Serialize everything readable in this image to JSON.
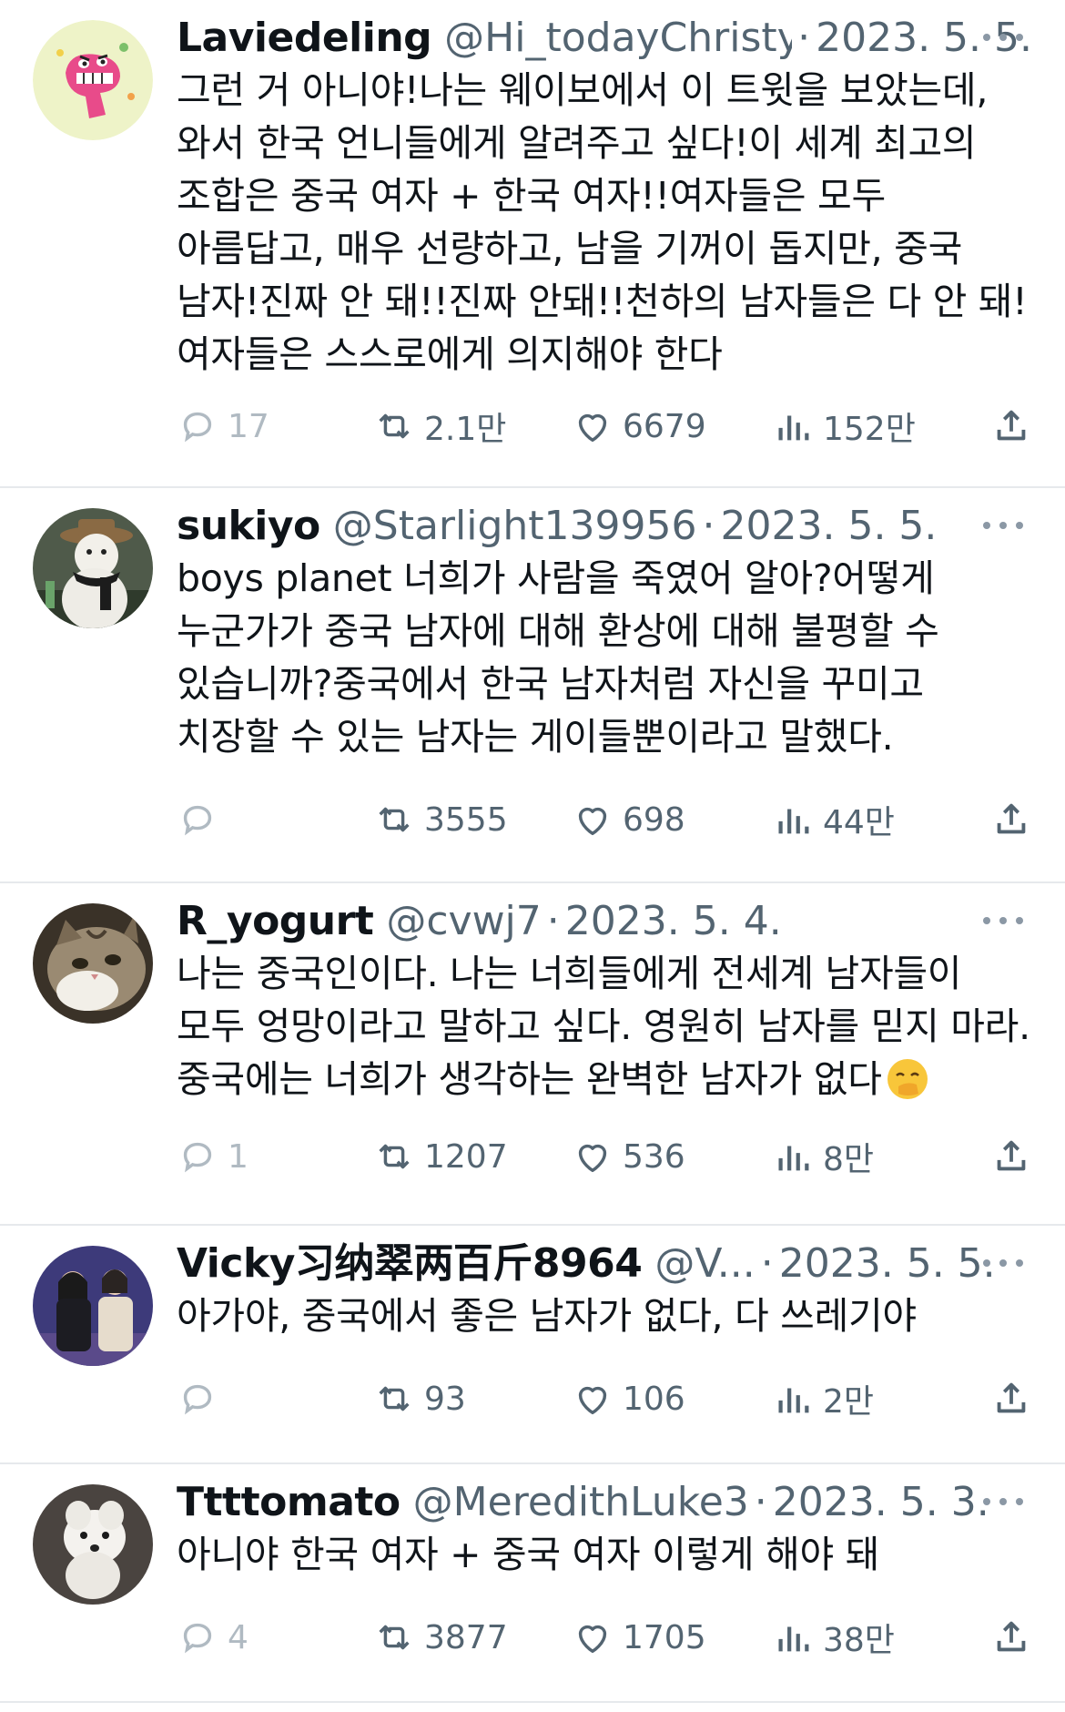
{
  "tweets": [
    {
      "name": "Laviedeling",
      "handle": "@Hi_todayChristy",
      "date": "2023. 5. 5.",
      "text": "그런 거 아니야!나는 웨이보에서 이 트윗을 보았는데, 와서 한국 언니들에게 알려주고 싶다!이 세계 최고의 조합은 중국 여자 + 한국 여자!!여자들은 모두 아름답고, 매우 선량하고, 남을 기꺼이 돕지만, 중국 남자!진짜 안 돼!!진짜 안돼!!천하의 남자들은 다 안 돼!여자들은 스스로에게 의지해야 한다",
      "replies": "17",
      "retweets": "2.1만",
      "likes": "6679",
      "views": "152만"
    },
    {
      "name": "sukiyo",
      "handle": "@Starlight139956",
      "date": "2023. 5. 5.",
      "text": "boys planet 너희가 사람을 죽였어 알아?어떻게 누군가가 중국 남자에 대해 환상에 대해 불평할 수 있습니까?중국에서 한국 남자처럼 자신을 꾸미고 치장할 수 있는 남자는 게이들뿐이라고 말했다.",
      "replies": "",
      "retweets": "3555",
      "likes": "698",
      "views": "44만"
    },
    {
      "name": "R_yogurt",
      "handle": "@cvwj7",
      "date": "2023. 5. 4.",
      "text": "나는 중국인이다. 나는 너희들에게 전세계 남자들이 모두 엉망이라고 말하고 싶다. 영원히 남자를 믿지 마라. 중국에는 너희가 생각하는 완벽한 남자가 없다",
      "replies": "1",
      "retweets": "1207",
      "likes": "536",
      "views": "8만"
    },
    {
      "name": "Vicky习纳翠两百斤8964",
      "handle": "@V...",
      "date": "2023. 5. 5.",
      "text": "아가야, 중국에서 좋은 남자가 없다, 다 쓰레기야",
      "replies": "",
      "retweets": "93",
      "likes": "106",
      "views": "2만"
    },
    {
      "name": "Ttttomato",
      "handle": "@MeredithLuke3",
      "date": "2023. 5. 3.",
      "text": "아니야 한국 여자 + 중국 여자 이렇게 해야 돼",
      "replies": "4",
      "retweets": "3877",
      "likes": "1705",
      "views": "38만"
    }
  ],
  "icons": {
    "reply": "reply-icon",
    "retweet": "retweet-icon",
    "like": "heart-icon",
    "views": "views-icon",
    "share": "share-icon",
    "more": "more-icon",
    "emoji": "face-with-hand-over-mouth-emoji"
  },
  "colors": {
    "text": "#0f1419",
    "secondary": "#536471",
    "divider": "#e6e9ec",
    "faded": "#b0bac2"
  }
}
